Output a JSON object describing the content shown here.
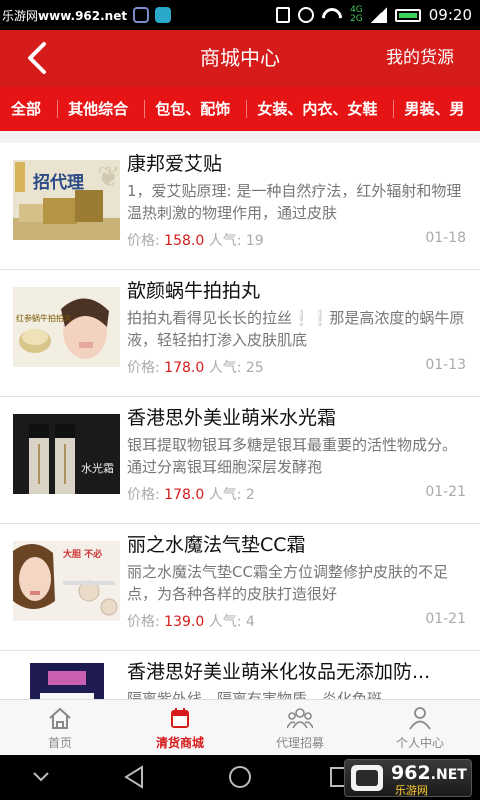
{
  "status_bar": {
    "watermark_prefix": "乐游网",
    "watermark_url": "www.962.net",
    "network_top": "4G",
    "network_bottom": "2G",
    "time": "09:20"
  },
  "header": {
    "title": "商城中心",
    "right_link": "我的货源"
  },
  "categories": [
    {
      "label": "全部"
    },
    {
      "label": "其他综合"
    },
    {
      "label": "包包、配饰"
    },
    {
      "label": "女装、内衣、女鞋"
    },
    {
      "label": "男装、男"
    }
  ],
  "list_labels": {
    "price_label": "价格:",
    "popularity_label": "人气:"
  },
  "thumb_text": {
    "item1": "招代理",
    "item2": "红参蜗牛拍拍丸",
    "item3": "水光霜",
    "item4": "大胆 不必"
  },
  "products": [
    {
      "title": "康邦爱艾贴",
      "desc": "1，爱艾贴原理: 是一种自然疗法，红外辐射和物理温热刺激的物理作用，通过皮肤",
      "price": "158.0",
      "popularity": "19",
      "date": "01-18"
    },
    {
      "title": "歆颜蜗牛拍拍丸",
      "desc": "拍拍丸看得见长长的拉丝❕❕那是高浓度的蜗牛原液，轻轻拍打渗入皮肤肌底",
      "price": "178.0",
      "popularity": "25",
      "date": "01-13"
    },
    {
      "title": "香港思外美业萌米水光霜",
      "desc": "银耳提取物银耳多糖是银耳最重要的活性物成分。通过分离银耳细胞深层发酵孢",
      "price": "178.0",
      "popularity": "2",
      "date": "01-21"
    },
    {
      "title": "丽之水魔法气垫CC霜",
      "desc": "丽之水魔法气垫CC霜全方位调整修护皮肤的不足点，为各种各样的皮肤打造很好",
      "price": "139.0",
      "popularity": "4",
      "date": "01-21"
    },
    {
      "title": "香港思好美业萌米化妆品无添加防...",
      "desc": "隔离紫外线，隔离有害物质，炎化色斑，",
      "price": "",
      "popularity": "",
      "date": ""
    }
  ],
  "tabbar": [
    {
      "label": "首页"
    },
    {
      "label": "清货商城"
    },
    {
      "label": "代理招募"
    },
    {
      "label": "个人中心"
    }
  ],
  "watermark": {
    "big": "962",
    "suffix": ".NET",
    "small": "乐游网"
  },
  "colors": {
    "brand_red": "#d61b1b",
    "category_bar": "#e61414",
    "price_red": "#d61b1b"
  }
}
